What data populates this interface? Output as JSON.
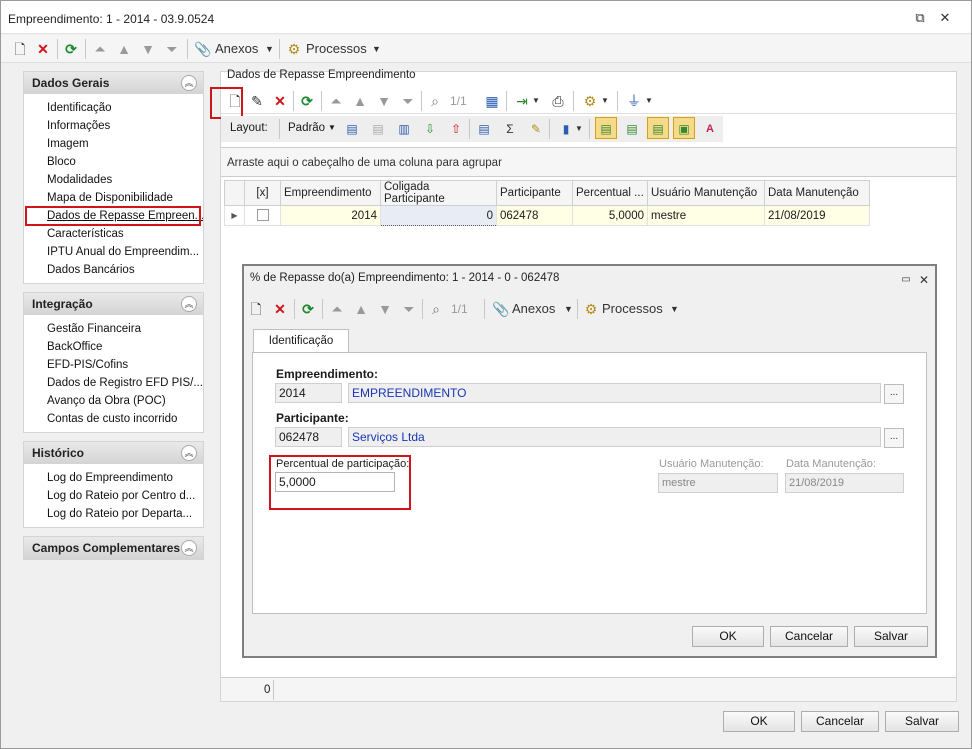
{
  "window": {
    "title": "Empreendimento: 1 - 2014 - 03.9.0524",
    "toolbar": {
      "anexos_label": "Anexos",
      "processos_label": "Processos"
    }
  },
  "sidebar": {
    "groups": [
      {
        "title": "Dados Gerais",
        "items": [
          "Identificação",
          "Informações",
          "Imagem",
          "Bloco",
          "Modalidades",
          "Mapa de Disponibilidade",
          "Dados de Repasse Empreen...",
          "Características",
          "IPTU Anual do Empreendim...",
          "Dados Bancários"
        ]
      },
      {
        "title": "Integração",
        "items": [
          "Gestão Financeira",
          "BackOffice",
          "EFD-PIS/Cofins",
          "Dados de Registro EFD PIS/...",
          "Avanço da Obra (POC)",
          "Contas de custo incorrido"
        ]
      },
      {
        "title": "Histórico",
        "items": [
          "Log do Empreendimento",
          "Log do Rateio por Centro d...",
          "Log do Rateio por Departa..."
        ]
      },
      {
        "title": "Campos Complementares",
        "items": []
      }
    ]
  },
  "main": {
    "title": "Dados de Repasse Empreendimento",
    "page_counter": "1/1",
    "layout_label": "Layout:",
    "layout_value": "Padrão",
    "group_by_hint": "Arraste aqui o cabeçalho de uma coluna para agrupar",
    "columns": [
      "[x]",
      "Empreendimento",
      "Coligada Participante",
      "Participante",
      "Percentual ...",
      "Usuário Manutenção",
      "Data Manutenção"
    ],
    "rows": [
      {
        "empreendimento": "2014",
        "coligada": "0",
        "participante": "062478",
        "percentual": "5,0000",
        "usuario": "mestre",
        "data": "21/08/2019"
      }
    ],
    "record_count": "0"
  },
  "dialog": {
    "title": "% de Repasse do(a) Empreendimento: 1 - 2014 - 0 - 062478",
    "page_counter": "1/1",
    "anexos_label": "Anexos",
    "processos_label": "Processos",
    "tab_label": "Identificação",
    "empreendimento_label": "Empreendimento:",
    "empreendimento_code": "2014",
    "empreendimento_name": "EMPREENDIMENTO",
    "participante_label": "Participante:",
    "participante_code": "062478",
    "participante_name": "Serviços Ltda",
    "percentual_label": "Percentual de participação:",
    "percentual_value": "5,0000",
    "usuario_label": "Usuário Manutenção:",
    "usuario_value": "mestre",
    "data_label": "Data Manutenção:",
    "data_value": "21/08/2019",
    "buttons": {
      "ok": "OK",
      "cancel": "Cancelar",
      "save": "Salvar"
    }
  },
  "footer_buttons": {
    "ok": "OK",
    "cancel": "Cancelar",
    "save": "Salvar"
  },
  "colors": {
    "highlight": "#d0141b",
    "link_blue": "#1a36b5",
    "row_bg": "#ffffe6"
  }
}
